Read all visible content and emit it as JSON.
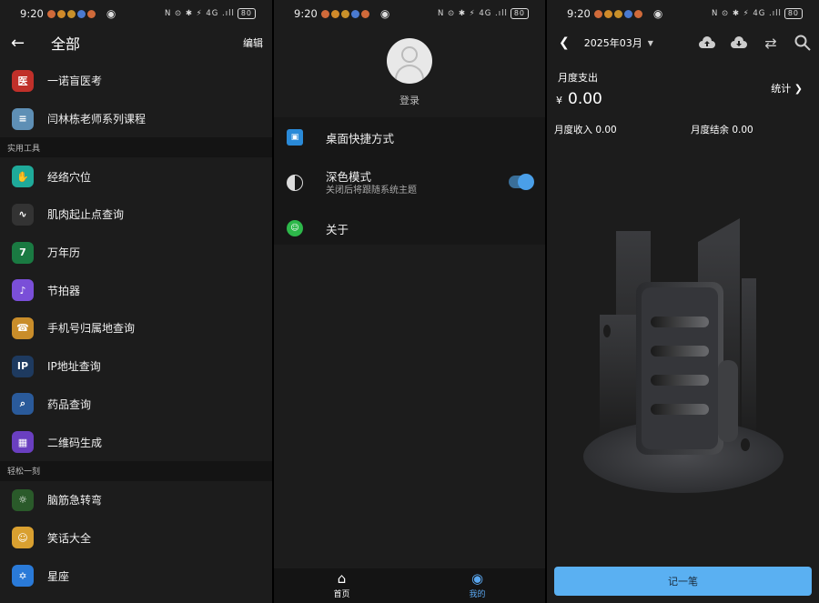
{
  "status_bar": {
    "time": "9:20",
    "signal": "N ⊙ ✱ ⚡ 4G .ıll",
    "battery": "80"
  },
  "panel_all": {
    "title": "全部",
    "edit": "编辑",
    "items_top": [
      {
        "label": "一诺盲医考",
        "icon": "medical-icon",
        "glyph": "医",
        "color": "#c0302a"
      },
      {
        "label": "闫林栋老师系列课程",
        "icon": "books-icon",
        "glyph": "≡",
        "color": "#5e8fb5"
      }
    ],
    "section_tools": "实用工具",
    "items_tools": [
      {
        "label": "经络穴位",
        "icon": "hand-icon",
        "glyph": "✋",
        "color": "#1faa9a"
      },
      {
        "label": "肌肉起止点查询",
        "icon": "stethoscope-icon",
        "glyph": "∿",
        "color": "#333333"
      },
      {
        "label": "万年历",
        "icon": "calendar-icon",
        "glyph": "7",
        "color": "#1a7a42"
      },
      {
        "label": "节拍器",
        "icon": "metronome-icon",
        "glyph": "♪",
        "color": "#7a4fd8"
      },
      {
        "label": "手机号归属地查询",
        "icon": "phone-location-icon",
        "glyph": "☎",
        "color": "#c98d2a"
      },
      {
        "label": "IP地址查询",
        "icon": "ip-pin-icon",
        "glyph": "IP",
        "color": "#1e3a5f"
      },
      {
        "label": "药品查询",
        "icon": "medicine-search-icon",
        "glyph": "⌕",
        "color": "#2a5a9a"
      },
      {
        "label": "二维码生成",
        "icon": "qr-code-icon",
        "glyph": "▦",
        "color": "#6a3fc0"
      }
    ],
    "section_relax": "轻松一刻",
    "items_relax": [
      {
        "label": "脑筋急转弯",
        "icon": "bulb-icon",
        "glyph": "☼",
        "color": "#2a5a2a"
      },
      {
        "label": "笑话大全",
        "icon": "laugh-icon",
        "glyph": "☺",
        "color": "#d9a030"
      },
      {
        "label": "星座",
        "icon": "star-of-david-icon",
        "glyph": "✡",
        "color": "#2a7ad8"
      }
    ]
  },
  "panel_mine": {
    "login": "登录",
    "shortcut": "桌面快捷方式",
    "dark_mode": "深色模式",
    "dark_mode_sub": "关闭后将跟随系统主题",
    "dark_mode_on": true,
    "about": "关于",
    "nav_home": "首页",
    "nav_mine": "我的"
  },
  "panel_ledger": {
    "month": "2025年03月",
    "expense_label": "月度支出",
    "currency": "¥",
    "expense_value": "0.00",
    "stats": "统计",
    "income": "月度收入 0.00",
    "balance": "月度结余 0.00",
    "add_button": "记一笔"
  }
}
